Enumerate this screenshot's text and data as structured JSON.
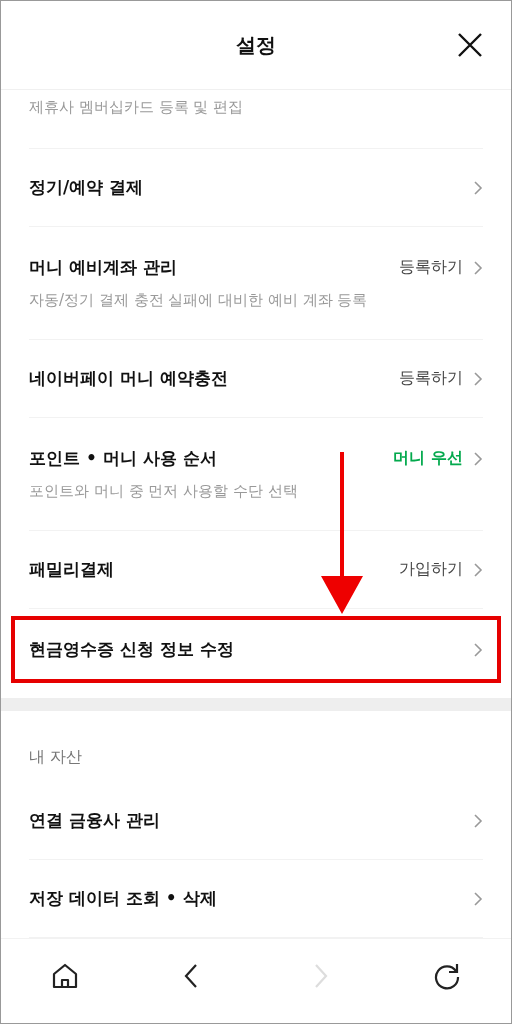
{
  "header": {
    "title": "설정"
  },
  "groups": [
    {
      "items": [
        {
          "subtitle": "제휴사 멤버십카드 등록 및 편집",
          "highlighted": false
        },
        {
          "title": "정기/예약 결제",
          "highlighted": false
        },
        {
          "title": "머니 예비계좌 관리",
          "value": "등록하기",
          "emphasized": false,
          "subtitle": "자동/정기 결제 충전 실패에 대비한 예비 계좌 등록",
          "highlighted": false
        },
        {
          "title": "네이버페이 머니 예약충전",
          "value": "등록하기",
          "emphasized": false,
          "highlighted": false
        },
        {
          "title": "포인트 • 머니 사용 순서",
          "value": "머니 우선",
          "emphasized": true,
          "subtitle": "포인트와 머니 중 먼저 사용할 수단 선택",
          "highlighted": false
        },
        {
          "title": "패밀리결제",
          "value": "가입하기",
          "emphasized": false,
          "highlighted": false
        },
        {
          "title": "현금영수증 신청 정보 수정",
          "highlighted": true
        }
      ]
    },
    {
      "heading": "내 자산",
      "items": [
        {
          "title": "연결 금융사 관리",
          "highlighted": false
        },
        {
          "title": "저장 데이터 조회 • 삭제",
          "highlighted": false
        }
      ]
    }
  ],
  "bottom_nav": [
    {
      "kind": "home",
      "disabled": false
    },
    {
      "kind": "back",
      "disabled": false
    },
    {
      "kind": "forward",
      "disabled": true
    },
    {
      "kind": "refresh",
      "disabled": false
    }
  ]
}
